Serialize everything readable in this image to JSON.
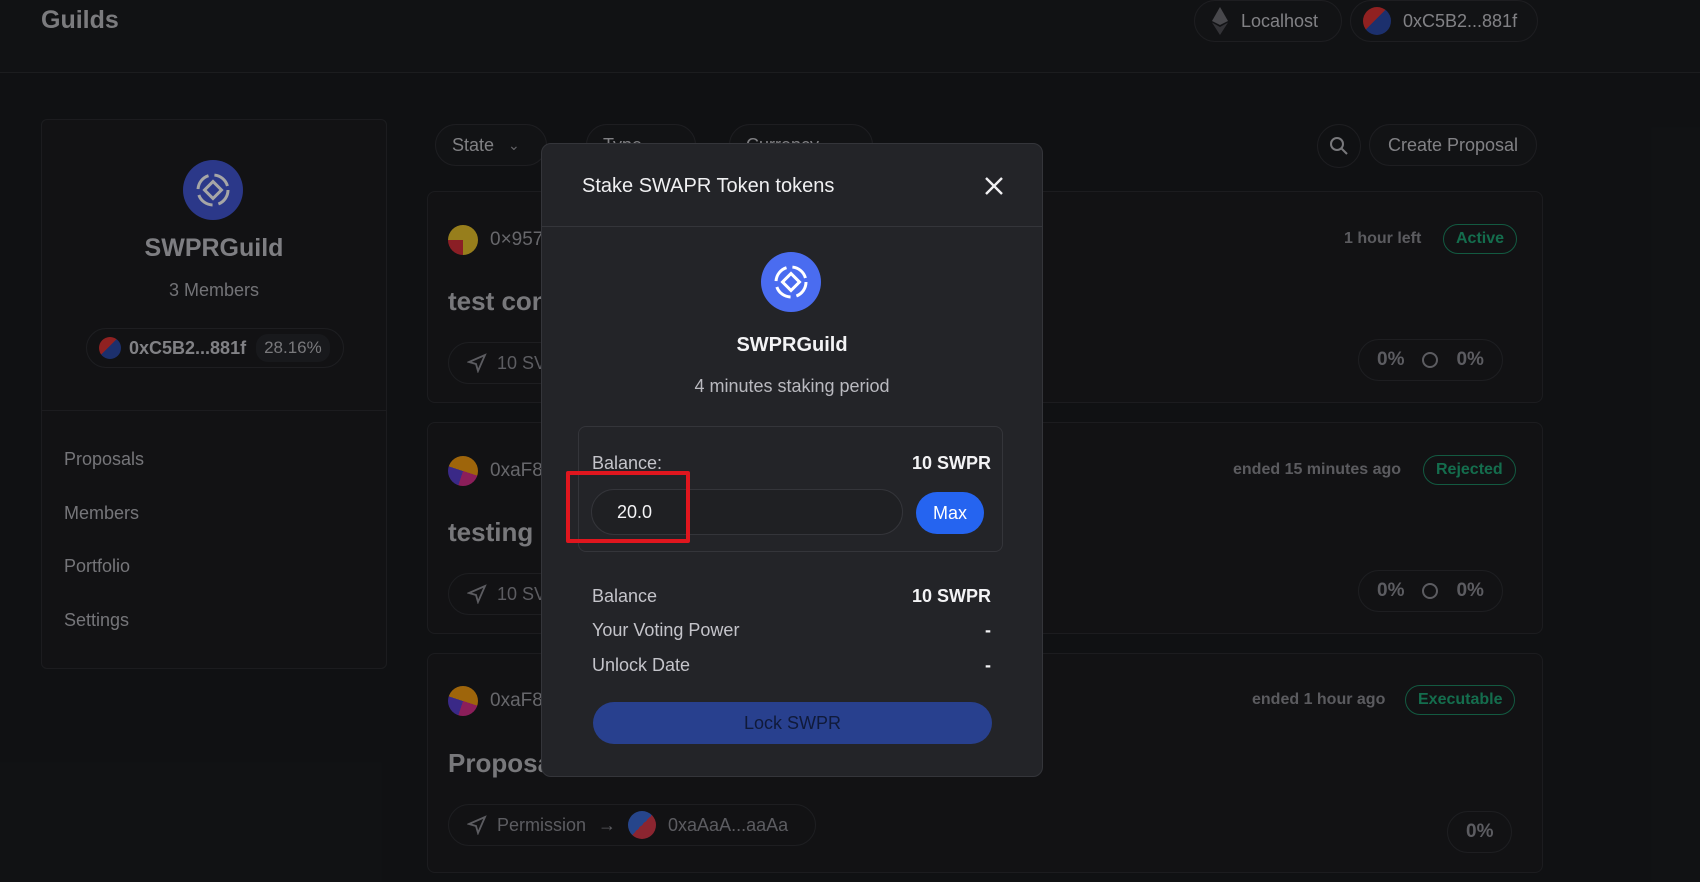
{
  "header": {
    "title": "Guilds",
    "network_label": "Localhost",
    "wallet_label": "0xC5B2...881f"
  },
  "sidebar": {
    "guild_name": "SWPRGuild",
    "members_text": "3 Members",
    "address": "0xC5B2...881f",
    "voting_share": "28.16%",
    "nav": [
      "Proposals",
      "Members",
      "Portfolio",
      "Settings"
    ]
  },
  "filters": {
    "state_label": "State",
    "type_label": "Type",
    "currency_label": "Currency",
    "create_label": "Create Proposal"
  },
  "proposals": [
    {
      "author": "0×957",
      "title": "test con",
      "action": "10 SV",
      "time": "1 hour left",
      "status": "Active",
      "vote_for": "0%",
      "vote_against": "0%"
    },
    {
      "author": "0xaF8",
      "title": "testing p",
      "action": "10 SV",
      "time": "ended 15 minutes ago",
      "status": "Rejected",
      "vote_for": "0%",
      "vote_against": "0%"
    },
    {
      "author": "0xaF8",
      "title": "Proposa",
      "action": "Permission",
      "action_target": "0xaAaA...aaAa",
      "time": "ended 1 hour ago",
      "status": "Executable",
      "vote_for": "0%"
    }
  ],
  "modal": {
    "title": "Stake SWAPR Token tokens",
    "guild_name": "SWPRGuild",
    "period": "4 minutes staking period",
    "balance_label": "Balance:",
    "balance_value": "10 SWPR",
    "amount_value": "20.0",
    "max_label": "Max",
    "info": [
      {
        "label": "Balance",
        "value": "10 SWPR"
      },
      {
        "label": "Your Voting Power",
        "value": "-"
      },
      {
        "label": "Unlock Date",
        "value": "-"
      }
    ],
    "lock_label": "Lock SWPR"
  },
  "colors": {
    "accent": "#2564f0",
    "status_green": "#20a877",
    "highlight_red": "#e0161e"
  }
}
